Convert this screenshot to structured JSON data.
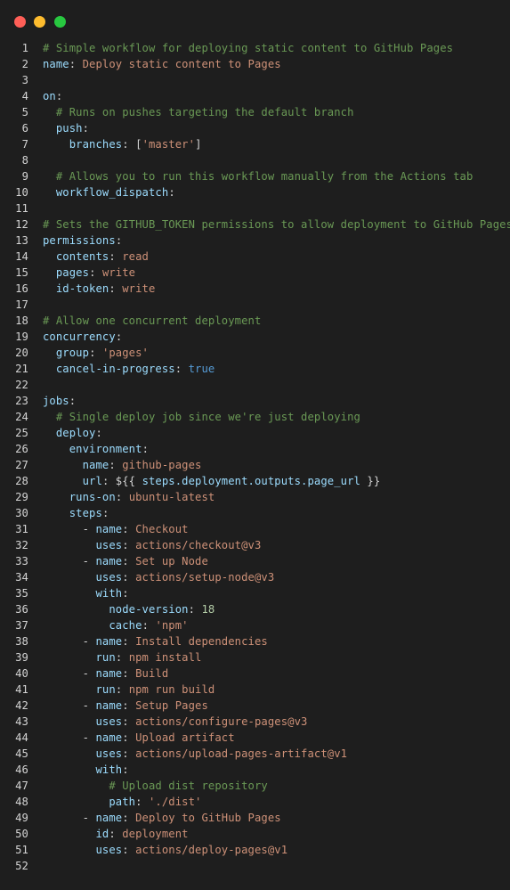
{
  "window": {
    "controls": [
      {
        "name": "close",
        "color": "#ff5f57"
      },
      {
        "name": "minimize",
        "color": "#febc2e"
      },
      {
        "name": "maximize",
        "color": "#28c840"
      }
    ]
  },
  "editor": {
    "lines": [
      {
        "n": "1",
        "tokens": [
          {
            "t": "# Simple workflow for deploying static content to GitHub Pages",
            "c": "comment"
          }
        ]
      },
      {
        "n": "2",
        "tokens": [
          {
            "t": "name",
            "c": "key"
          },
          {
            "t": ": ",
            "c": "punc"
          },
          {
            "t": "Deploy static content to Pages",
            "c": "str"
          }
        ]
      },
      {
        "n": "3",
        "tokens": []
      },
      {
        "n": "4",
        "tokens": [
          {
            "t": "on",
            "c": "key"
          },
          {
            "t": ":",
            "c": "punc"
          }
        ]
      },
      {
        "n": "5",
        "tokens": [
          {
            "t": "  # Runs on pushes targeting the default branch",
            "c": "comment"
          }
        ]
      },
      {
        "n": "6",
        "tokens": [
          {
            "t": "  ",
            "c": "punc"
          },
          {
            "t": "push",
            "c": "key"
          },
          {
            "t": ":",
            "c": "punc"
          }
        ]
      },
      {
        "n": "7",
        "tokens": [
          {
            "t": "    ",
            "c": "punc"
          },
          {
            "t": "branches",
            "c": "key"
          },
          {
            "t": ": [",
            "c": "punc"
          },
          {
            "t": "'master'",
            "c": "str"
          },
          {
            "t": "]",
            "c": "punc"
          }
        ]
      },
      {
        "n": "8",
        "tokens": []
      },
      {
        "n": "9",
        "tokens": [
          {
            "t": "  # Allows you to run this workflow manually from the Actions tab",
            "c": "comment"
          }
        ]
      },
      {
        "n": "10",
        "tokens": [
          {
            "t": "  ",
            "c": "punc"
          },
          {
            "t": "workflow_dispatch",
            "c": "key"
          },
          {
            "t": ":",
            "c": "punc"
          }
        ]
      },
      {
        "n": "11",
        "tokens": []
      },
      {
        "n": "12",
        "tokens": [
          {
            "t": "# Sets the GITHUB_TOKEN permissions to allow deployment to GitHub Pages",
            "c": "comment"
          }
        ]
      },
      {
        "n": "13",
        "tokens": [
          {
            "t": "permissions",
            "c": "key"
          },
          {
            "t": ":",
            "c": "punc"
          }
        ]
      },
      {
        "n": "14",
        "tokens": [
          {
            "t": "  ",
            "c": "punc"
          },
          {
            "t": "contents",
            "c": "key"
          },
          {
            "t": ": ",
            "c": "punc"
          },
          {
            "t": "read",
            "c": "str"
          }
        ]
      },
      {
        "n": "15",
        "tokens": [
          {
            "t": "  ",
            "c": "punc"
          },
          {
            "t": "pages",
            "c": "key"
          },
          {
            "t": ": ",
            "c": "punc"
          },
          {
            "t": "write",
            "c": "str"
          }
        ]
      },
      {
        "n": "16",
        "tokens": [
          {
            "t": "  ",
            "c": "punc"
          },
          {
            "t": "id-token",
            "c": "key"
          },
          {
            "t": ": ",
            "c": "punc"
          },
          {
            "t": "write",
            "c": "str"
          }
        ]
      },
      {
        "n": "17",
        "tokens": []
      },
      {
        "n": "18",
        "tokens": [
          {
            "t": "# Allow one concurrent deployment",
            "c": "comment"
          }
        ]
      },
      {
        "n": "19",
        "tokens": [
          {
            "t": "concurrency",
            "c": "key"
          },
          {
            "t": ":",
            "c": "punc"
          }
        ]
      },
      {
        "n": "20",
        "tokens": [
          {
            "t": "  ",
            "c": "punc"
          },
          {
            "t": "group",
            "c": "key"
          },
          {
            "t": ": ",
            "c": "punc"
          },
          {
            "t": "'pages'",
            "c": "str"
          }
        ]
      },
      {
        "n": "21",
        "tokens": [
          {
            "t": "  ",
            "c": "punc"
          },
          {
            "t": "cancel-in-progress",
            "c": "key"
          },
          {
            "t": ": ",
            "c": "punc"
          },
          {
            "t": "true",
            "c": "kw"
          }
        ]
      },
      {
        "n": "22",
        "tokens": []
      },
      {
        "n": "23",
        "tokens": [
          {
            "t": "jobs",
            "c": "key"
          },
          {
            "t": ":",
            "c": "punc"
          }
        ]
      },
      {
        "n": "24",
        "tokens": [
          {
            "t": "  # Single deploy job since we're just deploying",
            "c": "comment"
          }
        ]
      },
      {
        "n": "25",
        "tokens": [
          {
            "t": "  ",
            "c": "punc"
          },
          {
            "t": "deploy",
            "c": "key"
          },
          {
            "t": ":",
            "c": "punc"
          }
        ]
      },
      {
        "n": "26",
        "tokens": [
          {
            "t": "    ",
            "c": "punc"
          },
          {
            "t": "environment",
            "c": "key"
          },
          {
            "t": ":",
            "c": "punc"
          }
        ]
      },
      {
        "n": "27",
        "tokens": [
          {
            "t": "      ",
            "c": "punc"
          },
          {
            "t": "name",
            "c": "key"
          },
          {
            "t": ": ",
            "c": "punc"
          },
          {
            "t": "github-pages",
            "c": "str"
          }
        ]
      },
      {
        "n": "28",
        "tokens": [
          {
            "t": "      ",
            "c": "punc"
          },
          {
            "t": "url",
            "c": "key"
          },
          {
            "t": ": ${{ ",
            "c": "punc"
          },
          {
            "t": "steps.deployment.outputs.page_url",
            "c": "ident"
          },
          {
            "t": " }}",
            "c": "punc"
          }
        ]
      },
      {
        "n": "29",
        "tokens": [
          {
            "t": "    ",
            "c": "punc"
          },
          {
            "t": "runs-on",
            "c": "key"
          },
          {
            "t": ": ",
            "c": "punc"
          },
          {
            "t": "ubuntu-latest",
            "c": "str"
          }
        ]
      },
      {
        "n": "30",
        "tokens": [
          {
            "t": "    ",
            "c": "punc"
          },
          {
            "t": "steps",
            "c": "key"
          },
          {
            "t": ":",
            "c": "punc"
          }
        ]
      },
      {
        "n": "31",
        "tokens": [
          {
            "t": "      - ",
            "c": "punc"
          },
          {
            "t": "name",
            "c": "key"
          },
          {
            "t": ": ",
            "c": "punc"
          },
          {
            "t": "Checkout",
            "c": "str"
          }
        ]
      },
      {
        "n": "32",
        "tokens": [
          {
            "t": "        ",
            "c": "punc"
          },
          {
            "t": "uses",
            "c": "key"
          },
          {
            "t": ": ",
            "c": "punc"
          },
          {
            "t": "actions/checkout@v3",
            "c": "str"
          }
        ]
      },
      {
        "n": "33",
        "tokens": [
          {
            "t": "      - ",
            "c": "punc"
          },
          {
            "t": "name",
            "c": "key"
          },
          {
            "t": ": ",
            "c": "punc"
          },
          {
            "t": "Set up Node",
            "c": "str"
          }
        ]
      },
      {
        "n": "34",
        "tokens": [
          {
            "t": "        ",
            "c": "punc"
          },
          {
            "t": "uses",
            "c": "key"
          },
          {
            "t": ": ",
            "c": "punc"
          },
          {
            "t": "actions/setup-node@v3",
            "c": "str"
          }
        ]
      },
      {
        "n": "35",
        "tokens": [
          {
            "t": "        ",
            "c": "punc"
          },
          {
            "t": "with",
            "c": "key"
          },
          {
            "t": ":",
            "c": "punc"
          }
        ]
      },
      {
        "n": "36",
        "tokens": [
          {
            "t": "          ",
            "c": "punc"
          },
          {
            "t": "node-version",
            "c": "key"
          },
          {
            "t": ": ",
            "c": "punc"
          },
          {
            "t": "18",
            "c": "num"
          }
        ]
      },
      {
        "n": "37",
        "tokens": [
          {
            "t": "          ",
            "c": "punc"
          },
          {
            "t": "cache",
            "c": "key"
          },
          {
            "t": ": ",
            "c": "punc"
          },
          {
            "t": "'npm'",
            "c": "str"
          }
        ]
      },
      {
        "n": "38",
        "tokens": [
          {
            "t": "      - ",
            "c": "punc"
          },
          {
            "t": "name",
            "c": "key"
          },
          {
            "t": ": ",
            "c": "punc"
          },
          {
            "t": "Install dependencies",
            "c": "str"
          }
        ]
      },
      {
        "n": "39",
        "tokens": [
          {
            "t": "        ",
            "c": "punc"
          },
          {
            "t": "run",
            "c": "key"
          },
          {
            "t": ": ",
            "c": "punc"
          },
          {
            "t": "npm install",
            "c": "str"
          }
        ]
      },
      {
        "n": "40",
        "tokens": [
          {
            "t": "      - ",
            "c": "punc"
          },
          {
            "t": "name",
            "c": "key"
          },
          {
            "t": ": ",
            "c": "punc"
          },
          {
            "t": "Build",
            "c": "str"
          }
        ]
      },
      {
        "n": "41",
        "tokens": [
          {
            "t": "        ",
            "c": "punc"
          },
          {
            "t": "run",
            "c": "key"
          },
          {
            "t": ": ",
            "c": "punc"
          },
          {
            "t": "npm run build",
            "c": "str"
          }
        ]
      },
      {
        "n": "42",
        "tokens": [
          {
            "t": "      - ",
            "c": "punc"
          },
          {
            "t": "name",
            "c": "key"
          },
          {
            "t": ": ",
            "c": "punc"
          },
          {
            "t": "Setup Pages",
            "c": "str"
          }
        ]
      },
      {
        "n": "43",
        "tokens": [
          {
            "t": "        ",
            "c": "punc"
          },
          {
            "t": "uses",
            "c": "key"
          },
          {
            "t": ": ",
            "c": "punc"
          },
          {
            "t": "actions/configure-pages@v3",
            "c": "str"
          }
        ]
      },
      {
        "n": "44",
        "tokens": [
          {
            "t": "      - ",
            "c": "punc"
          },
          {
            "t": "name",
            "c": "key"
          },
          {
            "t": ": ",
            "c": "punc"
          },
          {
            "t": "Upload artifact",
            "c": "str"
          }
        ]
      },
      {
        "n": "45",
        "tokens": [
          {
            "t": "        ",
            "c": "punc"
          },
          {
            "t": "uses",
            "c": "key"
          },
          {
            "t": ": ",
            "c": "punc"
          },
          {
            "t": "actions/upload-pages-artifact@v1",
            "c": "str"
          }
        ]
      },
      {
        "n": "46",
        "tokens": [
          {
            "t": "        ",
            "c": "punc"
          },
          {
            "t": "with",
            "c": "key"
          },
          {
            "t": ":",
            "c": "punc"
          }
        ]
      },
      {
        "n": "47",
        "tokens": [
          {
            "t": "          # Upload dist repository",
            "c": "comment"
          }
        ]
      },
      {
        "n": "48",
        "tokens": [
          {
            "t": "          ",
            "c": "punc"
          },
          {
            "t": "path",
            "c": "key"
          },
          {
            "t": ": ",
            "c": "punc"
          },
          {
            "t": "'./dist'",
            "c": "str"
          }
        ]
      },
      {
        "n": "49",
        "tokens": [
          {
            "t": "      - ",
            "c": "punc"
          },
          {
            "t": "name",
            "c": "key"
          },
          {
            "t": ": ",
            "c": "punc"
          },
          {
            "t": "Deploy to GitHub Pages",
            "c": "str"
          }
        ]
      },
      {
        "n": "50",
        "tokens": [
          {
            "t": "        ",
            "c": "punc"
          },
          {
            "t": "id",
            "c": "key"
          },
          {
            "t": ": ",
            "c": "punc"
          },
          {
            "t": "deployment",
            "c": "str"
          }
        ]
      },
      {
        "n": "51",
        "tokens": [
          {
            "t": "        ",
            "c": "punc"
          },
          {
            "t": "uses",
            "c": "key"
          },
          {
            "t": ": ",
            "c": "punc"
          },
          {
            "t": "actions/deploy-pages@v1",
            "c": "str"
          }
        ]
      },
      {
        "n": "52",
        "tokens": []
      }
    ]
  }
}
